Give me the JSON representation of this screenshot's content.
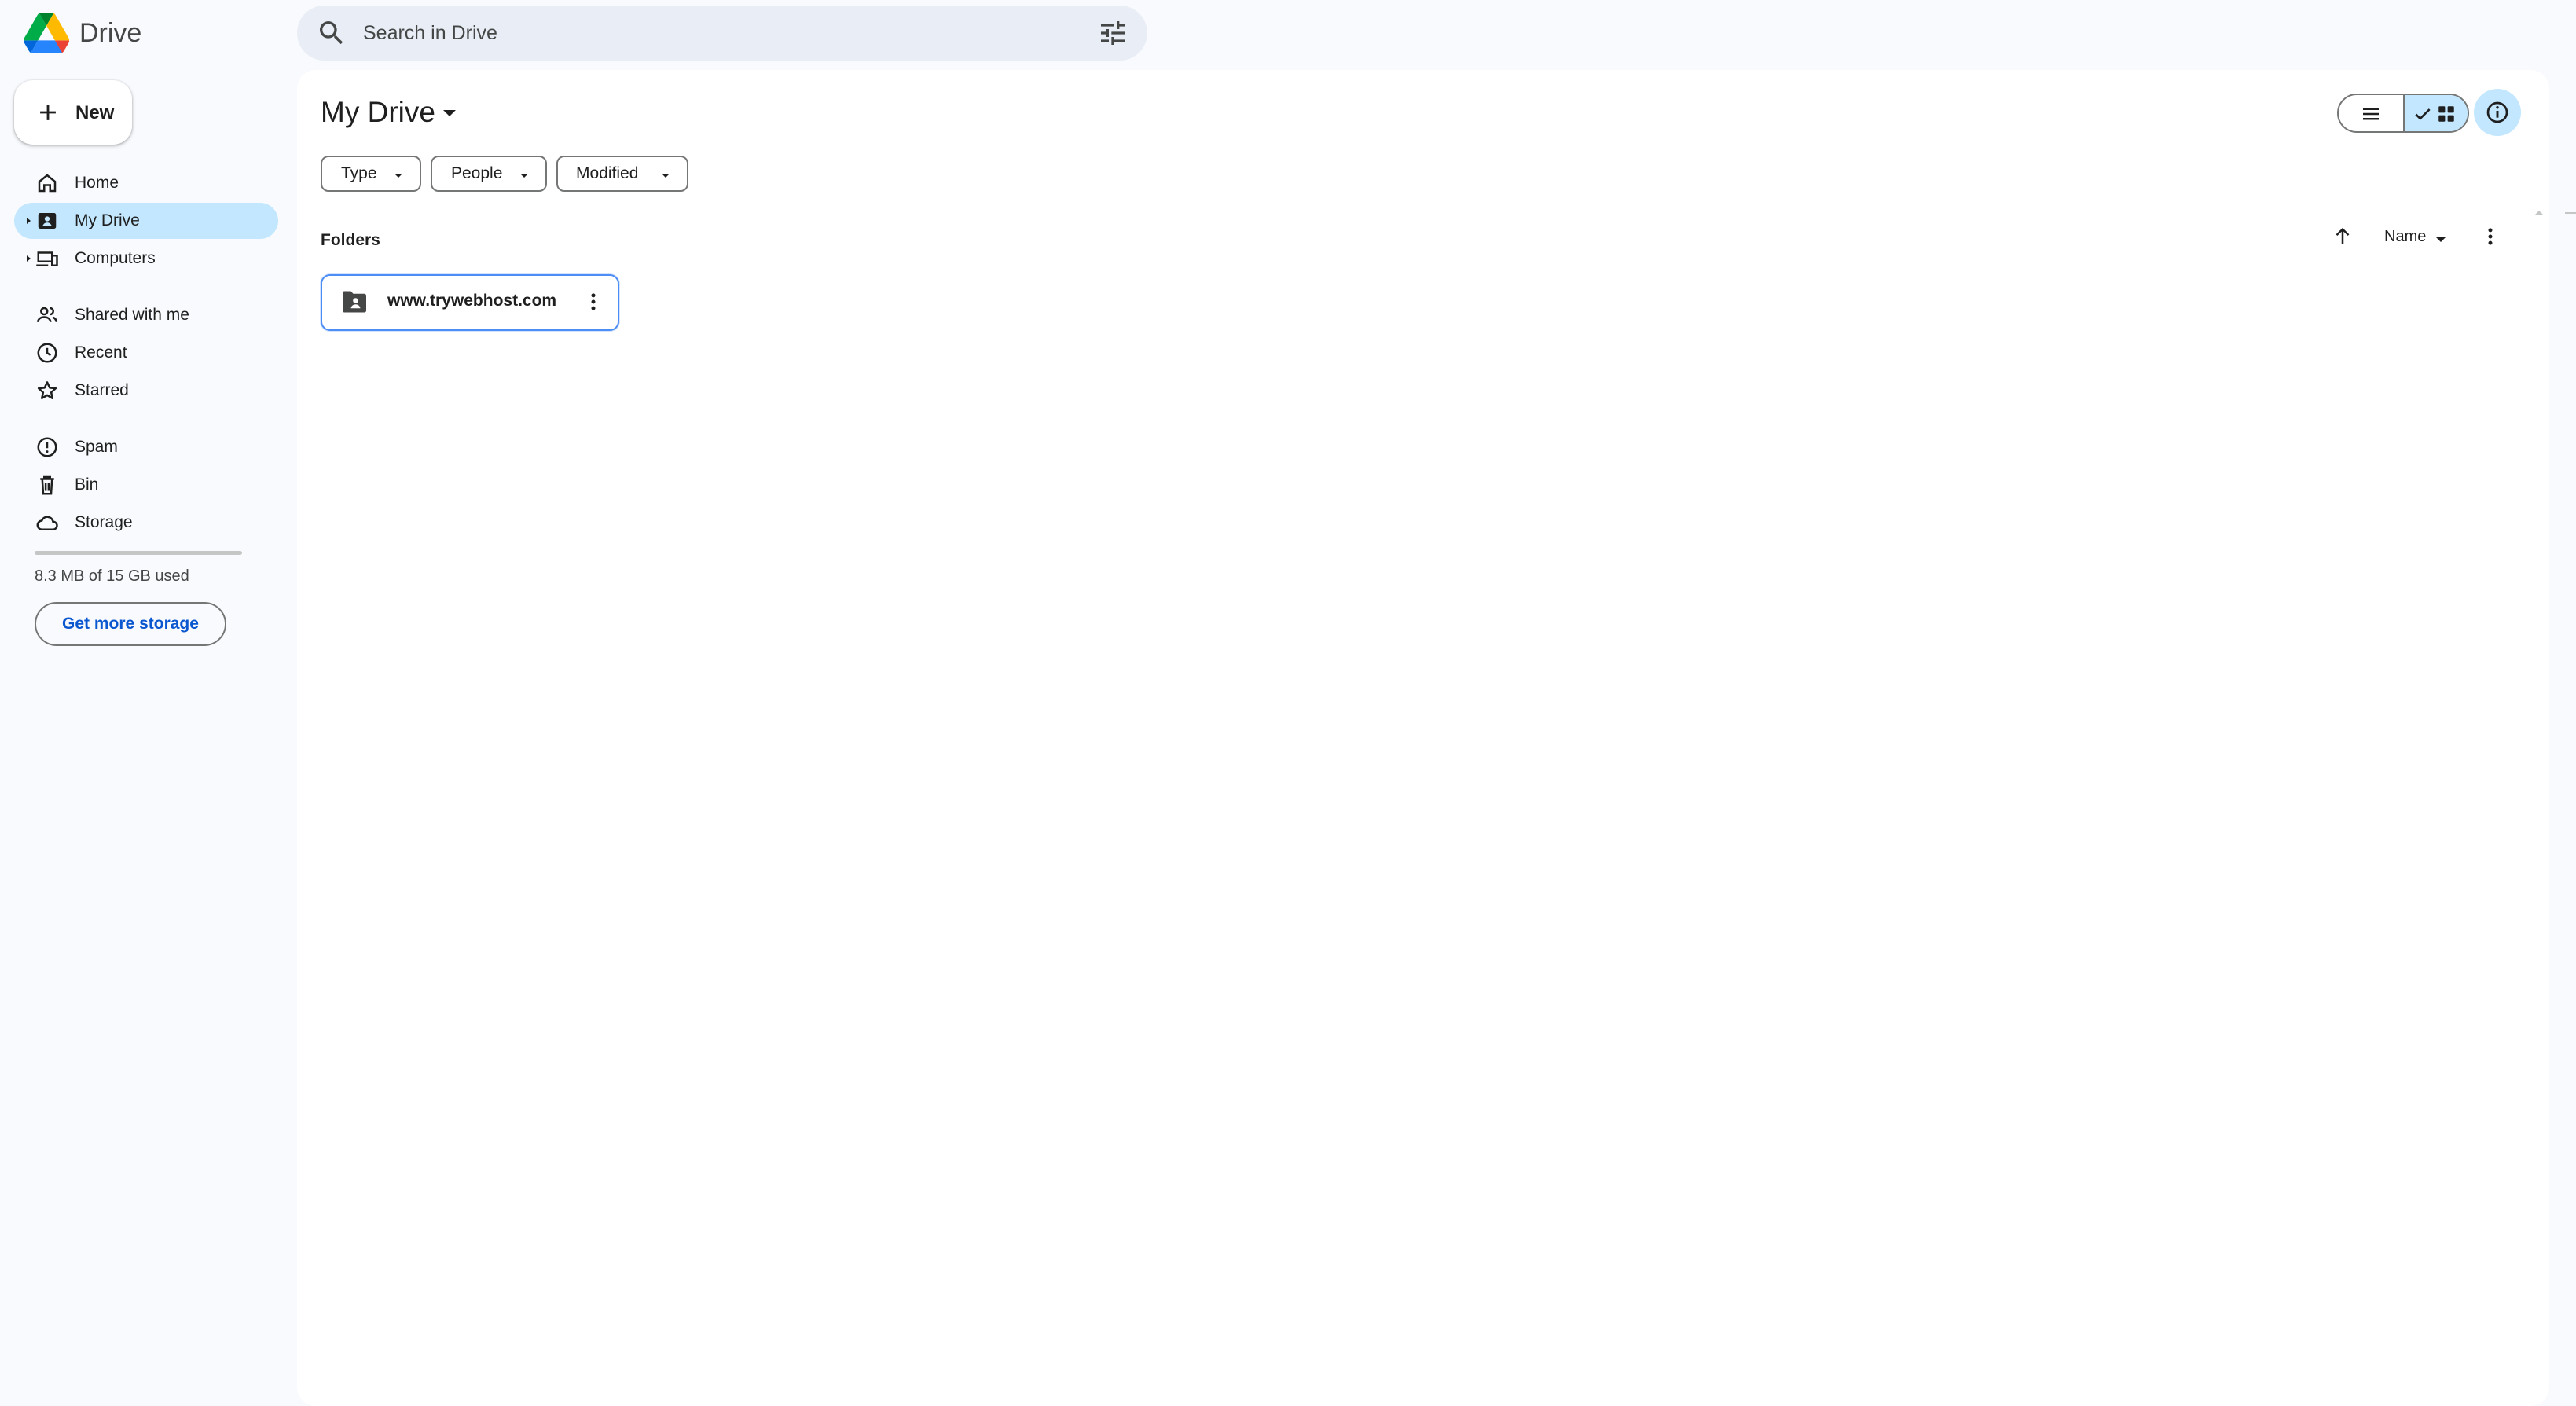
{
  "app": {
    "title": "Drive"
  },
  "search": {
    "placeholder": "Search in Drive"
  },
  "new_button": {
    "label": "New"
  },
  "sidebar": {
    "items": [
      {
        "label": "Home",
        "icon": "home-icon"
      },
      {
        "label": "My Drive",
        "icon": "my-drive-icon",
        "active": true,
        "expandable": true
      },
      {
        "label": "Computers",
        "icon": "computers-icon",
        "expandable": true
      },
      {
        "label": "Shared with me",
        "icon": "people-icon"
      },
      {
        "label": "Recent",
        "icon": "clock-icon"
      },
      {
        "label": "Starred",
        "icon": "star-icon"
      },
      {
        "label": "Spam",
        "icon": "spam-icon"
      },
      {
        "label": "Bin",
        "icon": "trash-icon"
      },
      {
        "label": "Storage",
        "icon": "cloud-icon"
      }
    ],
    "storage": {
      "used_text": "8.3 MB of 15 GB used",
      "used_fraction": 0.0006
    },
    "get_storage_label": "Get more storage"
  },
  "main": {
    "title": "My Drive",
    "filters": [
      {
        "label": "Type"
      },
      {
        "label": "People"
      },
      {
        "label": "Modified"
      }
    ],
    "view": {
      "mode": "grid"
    },
    "folders_heading": "Folders",
    "sort": {
      "label": "Name",
      "direction": "ascending"
    },
    "folders": [
      {
        "name": "www.trywebhost.com",
        "type": "shared-folder"
      }
    ]
  },
  "colors": {
    "background": "#f8fafd",
    "panel": "#ffffff",
    "active_nav": "#c2e7ff",
    "accent": "#0b57d0",
    "search_bg": "#e9eef6"
  }
}
